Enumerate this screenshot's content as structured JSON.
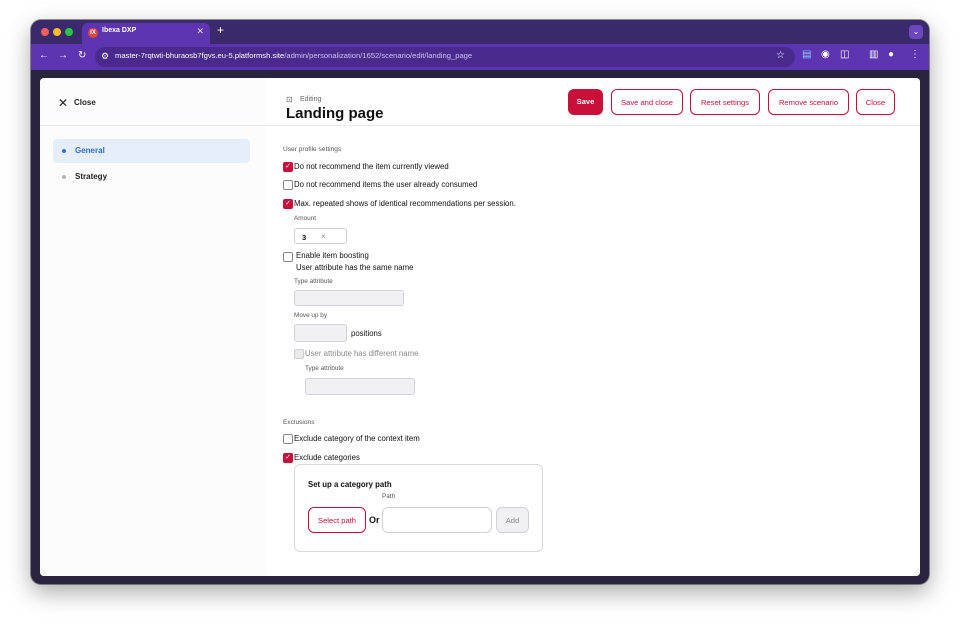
{
  "browser": {
    "tab_title": "Ibexa DXP",
    "tab_favicon_text": "IX",
    "url_host": "master-7rqtwti-bhuraosb7fgvs.eu-5.platformsh.site",
    "url_path": "/admin/personalization/1652/scenario/edit/landing_page"
  },
  "sidebar": {
    "close_label": "Close",
    "items": [
      {
        "label": "General",
        "active": true
      },
      {
        "label": "Strategy",
        "active": false
      }
    ]
  },
  "header": {
    "editing_label": "Editing",
    "title": "Landing page",
    "buttons": {
      "save": "Save",
      "save_close": "Save and close",
      "reset": "Reset settings",
      "remove": "Remove scenario",
      "close": "Close"
    }
  },
  "user_profile": {
    "section_title": "User profile settings",
    "option_viewed": {
      "label": "Do not recommend the item currently viewed",
      "checked": true
    },
    "option_consumed": {
      "label": "Do not recommend items the user already consumed",
      "checked": false
    },
    "option_repeated": {
      "label": "Max. repeated shows of identical recommendations per session.",
      "checked": true
    },
    "amount_label": "Amount",
    "amount_value": "3",
    "boosting": {
      "label": "Enable item boosting",
      "checked": false,
      "same_name_label": "User attribute has the same name",
      "type_attribute_label": "Type attribute",
      "move_up_label": "Move up by",
      "positions_label": "positions",
      "different_name_label": "User attribute has different name",
      "type_attribute_label_2": "Type attribute"
    }
  },
  "exclusions": {
    "section_title": "Exclusions",
    "context_item": {
      "label": "Exclude category of the context item",
      "checked": false
    },
    "categories": {
      "label": "Exclude categories",
      "checked": true
    },
    "category_path": {
      "title": "Set up a category path",
      "path_label": "Path",
      "select_button": "Select path",
      "or_label": "Or",
      "add_button": "Add"
    }
  },
  "colors": {
    "accent": "#c8103b",
    "browser_frame": "#5d35b0",
    "sidebar_active": "#e6eef9",
    "link_blue": "#2f6fd6"
  }
}
